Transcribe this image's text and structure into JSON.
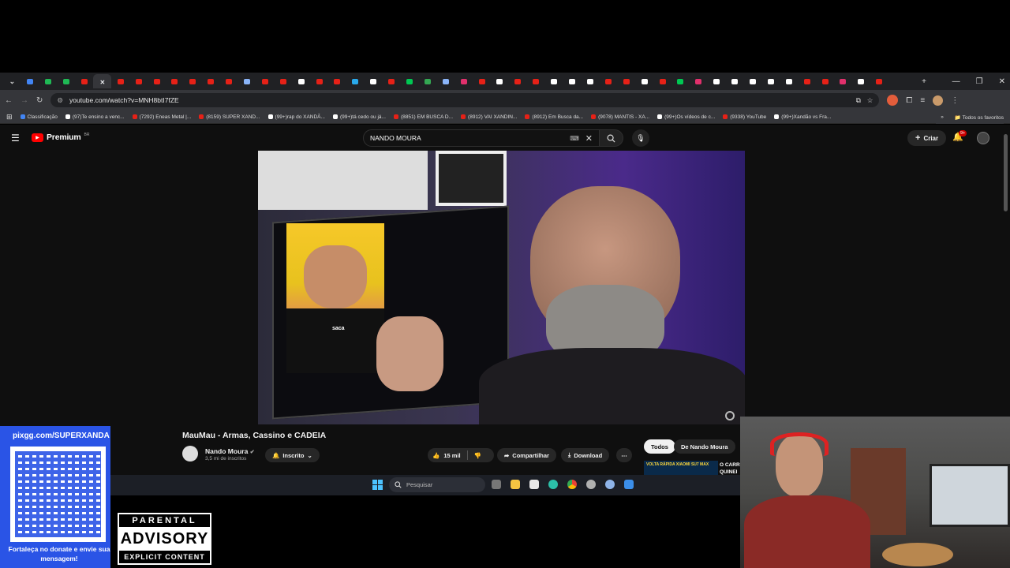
{
  "browser": {
    "tabs": [
      {
        "color": "#4285f4"
      },
      {
        "color": "#1fb955"
      },
      {
        "color": "#1fb955"
      },
      {
        "color": "#e62117"
      },
      {
        "color": "#e8eaed",
        "active": true
      },
      {
        "color": "#e62117"
      },
      {
        "color": "#e62117"
      },
      {
        "color": "#e62117"
      },
      {
        "color": "#e62117"
      },
      {
        "color": "#e62117"
      },
      {
        "color": "#e62117"
      },
      {
        "color": "#e62117"
      },
      {
        "color": "#8ab4f8"
      },
      {
        "color": "#e62117"
      },
      {
        "color": "#e62117"
      },
      {
        "color": "#ffffff"
      },
      {
        "color": "#e62117"
      },
      {
        "color": "#e62117"
      },
      {
        "color": "#29a9eb"
      },
      {
        "color": "#ffffff"
      },
      {
        "color": "#e62117"
      },
      {
        "color": "#00c853"
      },
      {
        "color": "#34a853"
      },
      {
        "color": "#8ab4f8"
      },
      {
        "color": "#e1306c"
      },
      {
        "color": "#e62117"
      },
      {
        "color": "#ffffff"
      },
      {
        "color": "#e62117"
      },
      {
        "color": "#e62117"
      },
      {
        "color": "#ffffff"
      },
      {
        "color": "#ffffff"
      },
      {
        "color": "#ffffff"
      },
      {
        "color": "#e62117"
      },
      {
        "color": "#e62117"
      },
      {
        "color": "#ffffff"
      },
      {
        "color": "#e62117"
      },
      {
        "color": "#00c853"
      },
      {
        "color": "#e1306c"
      },
      {
        "color": "#ffffff"
      },
      {
        "color": "#ffffff"
      },
      {
        "color": "#ffffff"
      },
      {
        "color": "#ffffff"
      },
      {
        "color": "#ffffff"
      },
      {
        "color": "#e62117"
      },
      {
        "color": "#e62117"
      },
      {
        "color": "#e1306c"
      },
      {
        "color": "#ffffff"
      },
      {
        "color": "#e62117"
      }
    ],
    "url": "youtube.com/watch?v=MNH8btI7fZE",
    "bookmarks": [
      {
        "label": "Classificação",
        "color": "#4285f4"
      },
      {
        "label": "(97)Te ensino a venc...",
        "color": "#ffffff"
      },
      {
        "label": "(7292) Eneas Metal |...",
        "color": "#e62117"
      },
      {
        "label": "(8159) SUPER XAND...",
        "color": "#e62117"
      },
      {
        "label": "(99+)rap do XANDÃ...",
        "color": "#ffffff"
      },
      {
        "label": "(99+)tá cedo ou já...",
        "color": "#ffffff"
      },
      {
        "label": "(8851) EM BUSCA D...",
        "color": "#e62117"
      },
      {
        "label": "(8912) VAI XANDIN...",
        "color": "#e62117"
      },
      {
        "label": "(8912) Em Busca da...",
        "color": "#e62117"
      },
      {
        "label": "(9078) MANTIS - XA...",
        "color": "#e62117"
      },
      {
        "label": "(99+)Os vídeos de c...",
        "color": "#ffffff"
      },
      {
        "label": "(9338) YouTube",
        "color": "#e62117"
      },
      {
        "label": "(99+)Xandão vs Fra...",
        "color": "#ffffff"
      }
    ],
    "all_bookmarks": "Todos os favoritos"
  },
  "youtube": {
    "logo": "Premium",
    "region": "BR",
    "search_value": "NANDO MOURA",
    "create_label": "Criar",
    "notif_count": "9+",
    "video_title": "MauMau - Armas, Cassino e CADEIA",
    "channel": "Nando Moura",
    "subscribers": "3,5 mi de inscritos",
    "subscribed_label": "Inscrito",
    "likes": "15 mil",
    "share_label": "Compartilhar",
    "download_label": "Download",
    "chips": [
      "Todos",
      "De Nando Moura"
    ],
    "rec_thumb_text": "VOLTA RÁPIDA XIAOMI SU7 MAX",
    "rec_title": "O CARR QUINEI"
  },
  "video": {
    "caption_word": "saca"
  },
  "taskbar": {
    "search_placeholder": "Pesquisar"
  },
  "overlay": {
    "donate_url": "pixgg.com/SUPERXANDA",
    "donate_text": "Fortaleça no donate e envie sua mensagem!",
    "advisory_top": "PARENTAL",
    "advisory_mid": "ADVISORY",
    "advisory_bottom": "EXPLICIT CONTENT"
  }
}
